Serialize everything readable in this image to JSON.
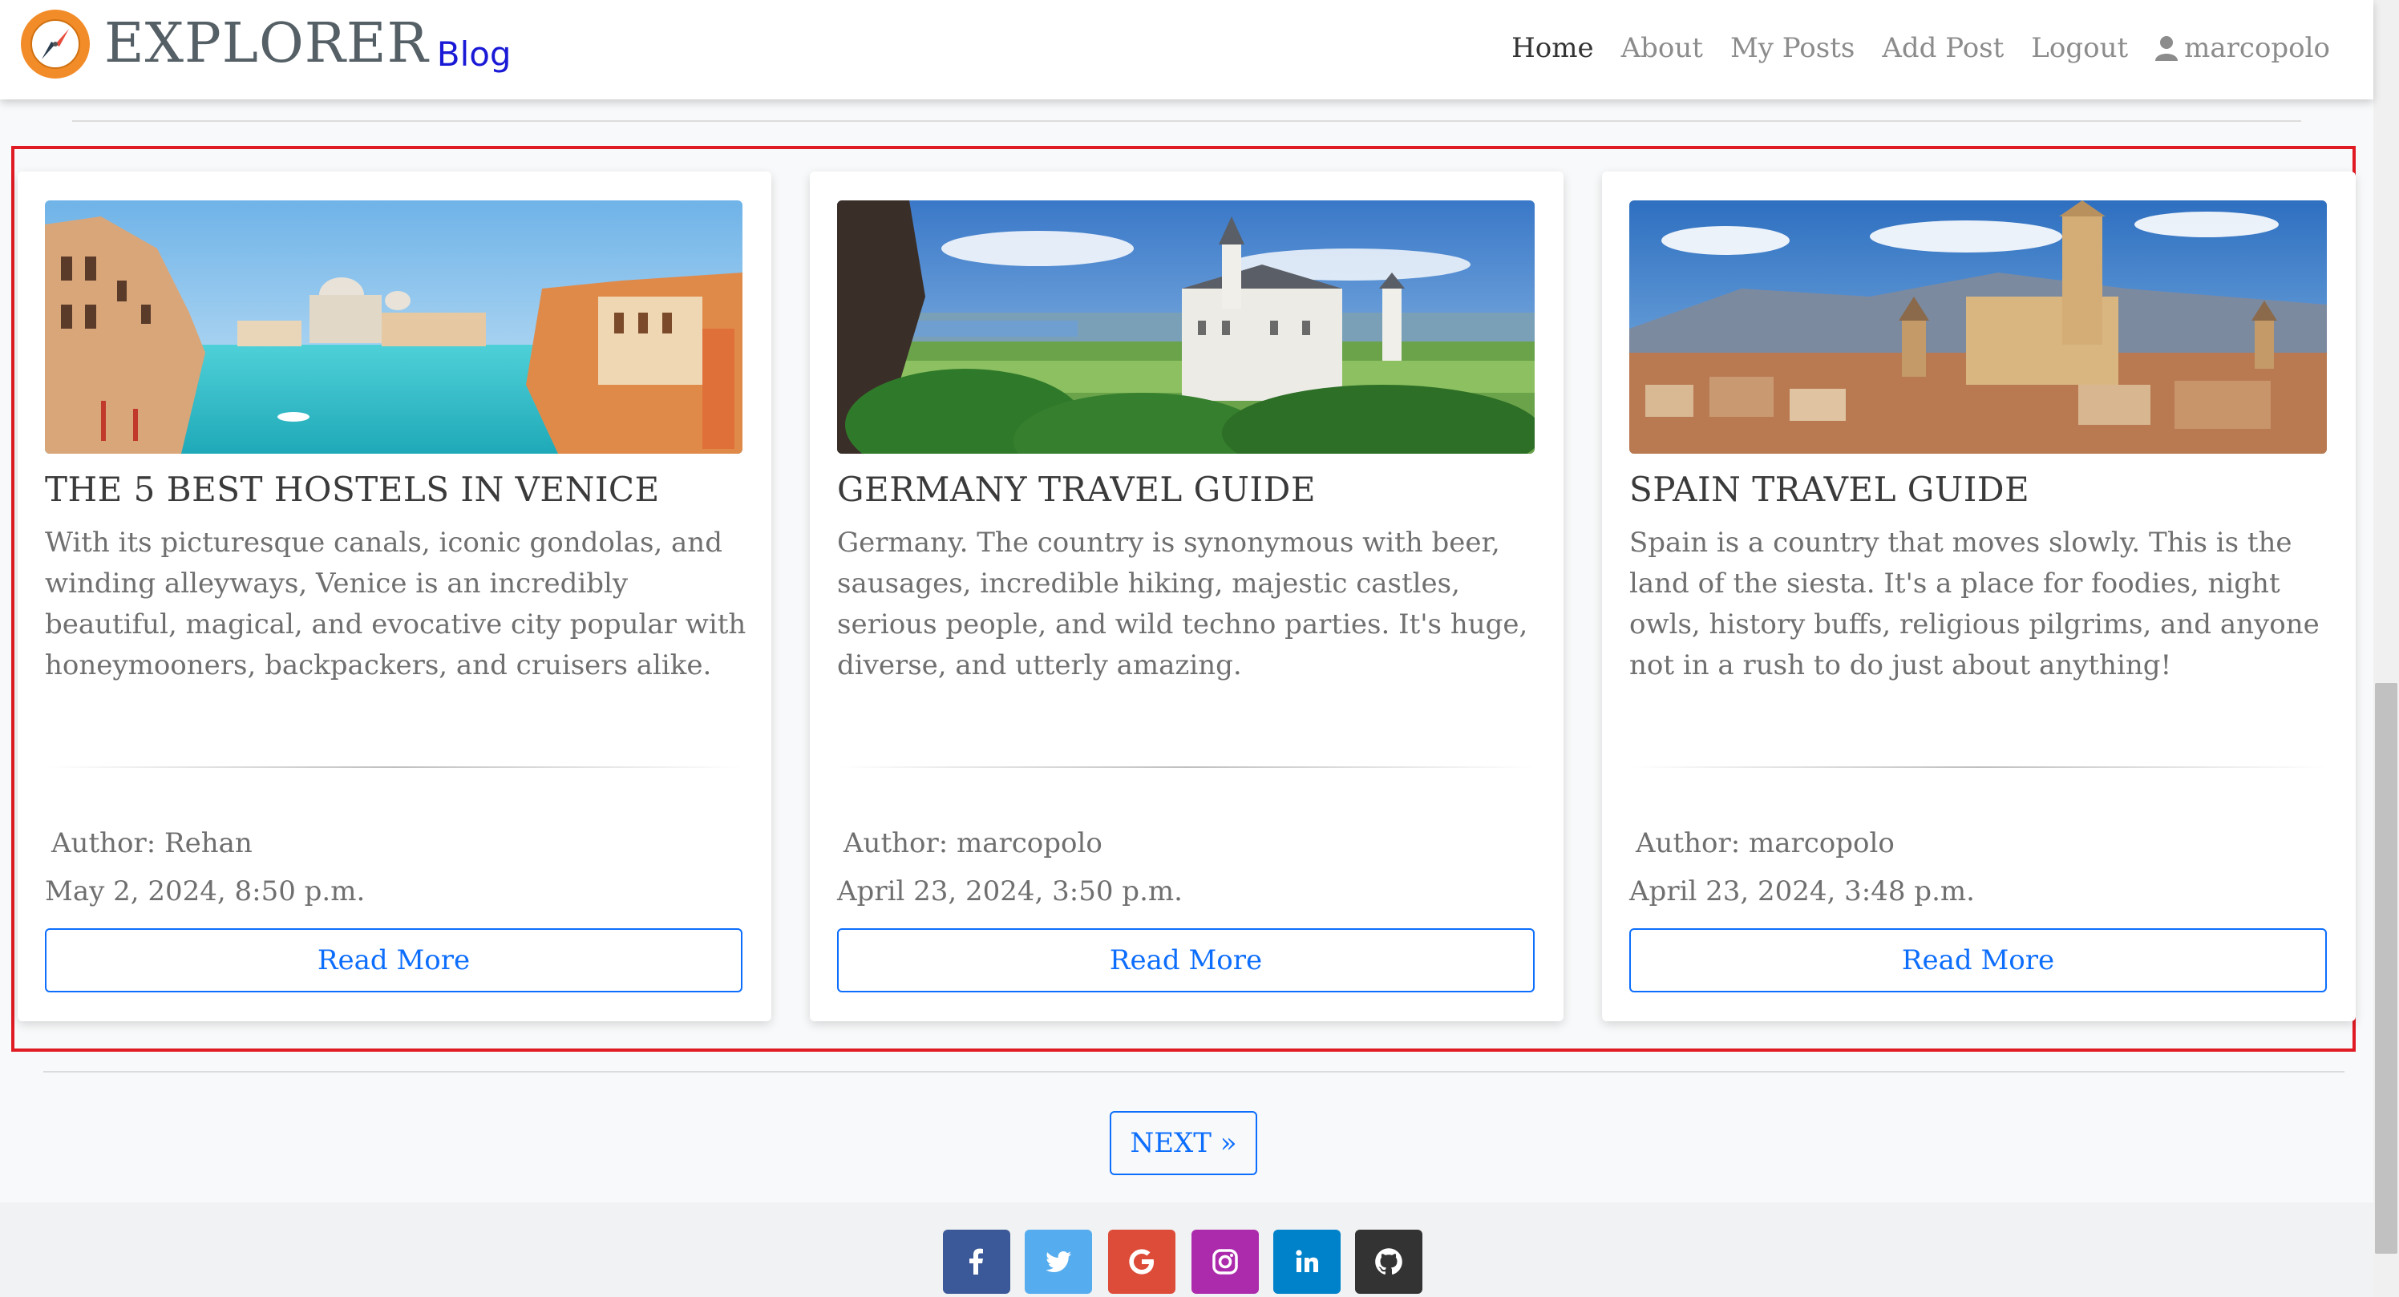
{
  "brand": {
    "title": "EXPLORER",
    "subtitle": "Blog",
    "logo_icon": "compass-icon"
  },
  "nav": {
    "items": [
      {
        "label": "Home",
        "active": true
      },
      {
        "label": "About"
      },
      {
        "label": "My Posts"
      },
      {
        "label": "Add Post"
      },
      {
        "label": "Logout"
      }
    ],
    "user": {
      "label": "marcopolo",
      "icon": "user-icon"
    }
  },
  "posts": [
    {
      "title": "THE 5 BEST HOSTELS IN VENICE",
      "excerpt": "With its picturesque canals, iconic gondolas, and winding alleyways, Venice is an incredibly beautiful, magical, and evocative city popular with honeymooners, backpackers, and cruisers alike.",
      "author": "Author: Rehan",
      "date": "May 2, 2024, 8:50 p.m.",
      "button": "Read More",
      "image": "venice-grand-canal"
    },
    {
      "title": "GERMANY TRAVEL GUIDE",
      "excerpt": "Germany. The country is synonymous with beer, sausages, incredible hiking, majestic castles, serious people, and wild techno parties. It's huge, diverse, and utterly amazing.",
      "author": "Author: marcopolo",
      "date": "April 23, 2024, 3:50 p.m.",
      "button": "Read More",
      "image": "neuschwanstein-castle"
    },
    {
      "title": "SPAIN TRAVEL GUIDE",
      "excerpt": "Spain is a country that moves slowly. This is the land of the siesta. It's a place for foodies, night owls, history buffs, religious pilgrims, and anyone not in a rush to do just about anything!",
      "author": "Author: marcopolo",
      "date": "April 23, 2024, 3:48 p.m.",
      "button": "Read More",
      "image": "segovia-cathedral"
    }
  ],
  "pagination": {
    "next_label": "NEXT »"
  },
  "footer": {
    "social": [
      {
        "name": "facebook-icon",
        "color": "#3b5998"
      },
      {
        "name": "twitter-icon",
        "color": "#55acee"
      },
      {
        "name": "google-icon",
        "color": "#dd4b39"
      },
      {
        "name": "instagram-icon",
        "color": "#ac2bac"
      },
      {
        "name": "linkedin-icon",
        "color": "#0082ca"
      },
      {
        "name": "github-icon",
        "color": "#333333"
      }
    ]
  },
  "colors": {
    "accent": "#0d6efd",
    "highlight": "#e01b24",
    "brand_orange": "#f28c28"
  }
}
